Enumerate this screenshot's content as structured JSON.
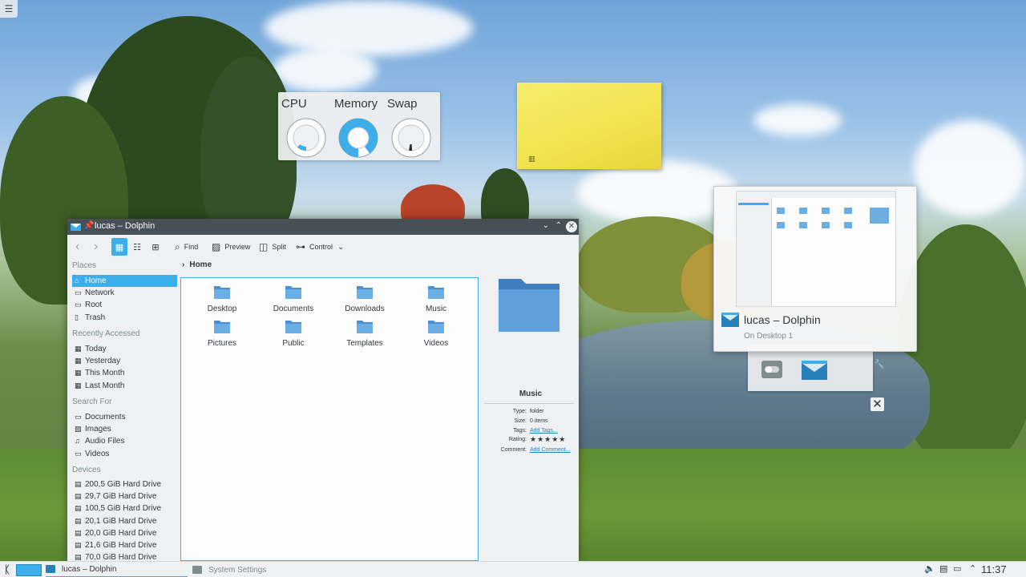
{
  "desktop": {
    "toolbox_icon": "hamburger-menu-icon"
  },
  "system_monitor": {
    "labels": [
      "CPU",
      "Memory",
      "Swap"
    ],
    "cpu_fraction": 0.12,
    "memory_fraction": 0.9,
    "swap_fraction": 0.02,
    "accent_color": "#3daee9"
  },
  "sticky_note": {
    "color": "#f2e24e",
    "config_icon": "note-config-icon"
  },
  "task_tooltip": {
    "title": "lucas – Dolphin",
    "subtitle": "On Desktop 1"
  },
  "dolphin": {
    "window_title": "lucas – Dolphin",
    "toolbar": {
      "find": "Find",
      "preview": "Preview",
      "split": "Split",
      "control": "Control"
    },
    "places": {
      "sections": {
        "places": "Places",
        "recent": "Recently Accessed",
        "search": "Search For",
        "devices": "Devices"
      },
      "places_items": [
        "Home",
        "Network",
        "Root",
        "Trash"
      ],
      "recent_items": [
        "Today",
        "Yesterday",
        "This Month",
        "Last Month"
      ],
      "search_items": [
        "Documents",
        "Images",
        "Audio Files",
        "Videos"
      ],
      "device_items": [
        "200,5 GiB Hard Drive",
        "29,7 GiB Hard Drive",
        "100,5 GiB Hard Drive",
        "20,1 GiB Hard Drive",
        "20,0 GiB Hard Drive",
        "21,6 GiB Hard Drive",
        "70,0 GiB Hard Drive"
      ]
    },
    "breadcrumb": "Home",
    "files": [
      "Desktop",
      "Documents",
      "Downloads",
      "Music",
      "Pictures",
      "Public",
      "Templates",
      "Videos"
    ],
    "info": {
      "name": "Music",
      "type_label": "Type:",
      "type_value": "folder",
      "size_label": "Size:",
      "size_value": "0 items",
      "tags_label": "Tags:",
      "tags_value": "Add Tags...",
      "rating_label": "Rating:",
      "rating_value": "★★★★★",
      "comment_label": "Comment:",
      "comment_value": "Add Comment..."
    }
  },
  "taskbar": {
    "tasks": [
      "lucas – Dolphin",
      "System Settings"
    ],
    "clock": "11:37",
    "accent_color": "#3daee9"
  }
}
